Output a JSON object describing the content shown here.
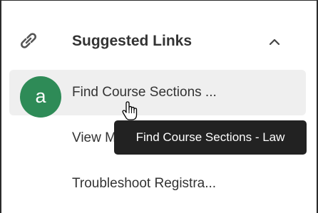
{
  "header": {
    "title": "Suggested Links",
    "icon": "link-icon",
    "collapse_icon": "chevron-up-icon"
  },
  "links": [
    {
      "label": "Find Course Sections ..."
    },
    {
      "label": "View My Courses"
    },
    {
      "label": "Troubleshoot Registra..."
    }
  ],
  "avatar": {
    "letter": "a",
    "color": "#2e8b57"
  },
  "tooltip": {
    "text": "Find Course Sections - Law"
  }
}
